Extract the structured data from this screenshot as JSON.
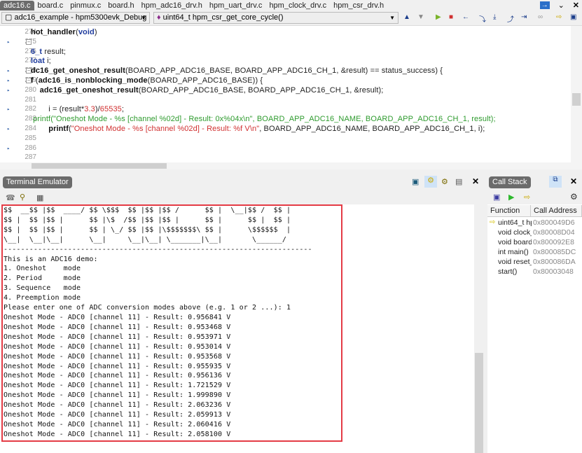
{
  "tabs": [
    "adc16.c",
    "board.c",
    "pinmux.c",
    "board.h",
    "hpm_adc16_drv.h",
    "hpm_uart_drv.c",
    "hpm_clock_drv.c",
    "hpm_csr_drv.h"
  ],
  "tab_controls": {
    "nav": "→",
    "dropdown": "⌄",
    "close": "✕"
  },
  "toolbar": {
    "project": "adc16_example - hpm5300evk_Debug",
    "function": "uint64_t hpm_csr_get_core_cycle()"
  },
  "editor": {
    "lines": [
      {
        "n": "274",
        "mark": false,
        "fold": false,
        "html": "<span class='b'>hot_handler</span>(<span class='kw'>void</span>)"
      },
      {
        "n": "275",
        "mark": true,
        "fold": true,
        "html": ""
      },
      {
        "n": "276",
        "mark": false,
        "fold": false,
        "html": "<span class='kw'>6_t</span> result;"
      },
      {
        "n": "277",
        "mark": false,
        "fold": false,
        "html": "<span class='kw'>loat</span> i;"
      },
      {
        "n": "278",
        "mark": true,
        "fold": true,
        "html": "<span class='b'>dc16_get_oneshot_result</span>(BOARD_APP_ADC16_BASE, BOARD_APP_ADC16_CH_1, &amp;result) == status_success) {"
      },
      {
        "n": "279",
        "mark": true,
        "fold": true,
        "html": "<span class='b'>f</span> (<span class='b'>adc16_is_nonblocking_mode</span>(BOARD_APP_ADC16_BASE)) {"
      },
      {
        "n": "280",
        "mark": true,
        "fold": false,
        "html": "    <span class='b'>adc16_get_oneshot_result</span>(BOARD_APP_ADC16_BASE, BOARD_APP_ADC16_CH_1, &amp;result);"
      },
      {
        "n": "281",
        "mark": false,
        "fold": false,
        "html": ""
      },
      {
        "n": "282",
        "mark": true,
        "fold": false,
        "html": "        i = (result*<span class='red'>3.3</span>)/<span class='red'>65535</span>;"
      },
      {
        "n": "283",
        "mark": false,
        "fold": false,
        "html": " <span class='grn'>printf(\"Oneshot Mode - %s [channel %02d] - Result: 0x%04x\\n\", BOARD_APP_ADC16_NAME, BOARD_APP_ADC16_CH_1, result);</span>"
      },
      {
        "n": "284",
        "mark": true,
        "fold": false,
        "html": "        <span class='b'>printf</span>(<span class='red'>\"Oneshot Mode - %s [channel %02d] - Result: %f V\\n\"</span>, BOARD_APP_ADC16_NAME, BOARD_APP_ADC16_CH_1, i);"
      },
      {
        "n": "285",
        "mark": false,
        "fold": false,
        "html": ""
      },
      {
        "n": "286",
        "mark": true,
        "fold": false,
        "html": ""
      },
      {
        "n": "287",
        "mark": false,
        "fold": false,
        "html": ""
      }
    ]
  },
  "terminal": {
    "title": "Terminal Emulator",
    "lines": [
      "$$  __$$ |$$  ____/ $$ \\$$$  $$ |$$ |$$ /      $$ |  \\__|$$ /  $$ |",
      "$$ |  $$ |$$ |      $$ |\\$  /$$ |$$ |$$ |      $$ |      $$ |  $$ |",
      "$$ |  $$ |$$ |      $$ | \\_/ $$ |$$ |\\$$$$$$$\\ $$ |      \\$$$$$$  |",
      "\\__|  \\__|\\__|      \\__|     \\__|\\__| \\_______|\\__|       \\______/",
      "------------------------------------------------------------------------",
      "This is an ADC16 demo:",
      "1. Oneshot    mode",
      "2. Period     mode",
      "3. Sequence   mode",
      "4. Preemption mode",
      "Please enter one of ADC conversion modes above (e.g. 1 or 2 ...): 1",
      "Oneshot Mode - ADC0 [channel 11] - Result: 0.956841 V",
      "Oneshot Mode - ADC0 [channel 11] - Result: 0.953468 V",
      "Oneshot Mode - ADC0 [channel 11] - Result: 0.953971 V",
      "Oneshot Mode - ADC0 [channel 11] - Result: 0.953014 V",
      "Oneshot Mode - ADC0 [channel 11] - Result: 0.953568 V",
      "Oneshot Mode - ADC0 [channel 11] - Result: 0.955935 V",
      "Oneshot Mode - ADC0 [channel 11] - Result: 0.956136 V",
      "Oneshot Mode - ADC0 [channel 11] - Result: 1.721529 V",
      "Oneshot Mode - ADC0 [channel 11] - Result: 1.999890 V",
      "Oneshot Mode - ADC0 [channel 11] - Result: 2.063236 V",
      "Oneshot Mode - ADC0 [channel 11] - Result: 2.059913 V",
      "Oneshot Mode - ADC0 [channel 11] - Result: 2.060416 V",
      "Oneshot Mode - ADC0 [channel 11] - Result: 2.058100 V"
    ]
  },
  "callstack": {
    "title": "Call Stack",
    "columns": [
      "Function",
      "Call Address"
    ],
    "rows": [
      {
        "fn": "uint64_t hpm_csr_get_core_cycle()",
        "addr": "0x800049D6",
        "current": true
      },
      {
        "fn": "void clock_cpu_delay_us()",
        "addr": "0x80008D04",
        "current": false
      },
      {
        "fn": "void board_delay_ms()",
        "addr": "0x800092E8",
        "current": false
      },
      {
        "fn": "int main()",
        "addr": "0x800085DC",
        "current": false
      },
      {
        "fn": "void reset_handler()",
        "addr": "0x800086DA",
        "current": false
      },
      {
        "fn": "start()",
        "addr": "0x80003048",
        "current": false
      }
    ]
  },
  "colors": {
    "highlight_border": "#e43b45",
    "active_tab": "#6b6b6b"
  }
}
